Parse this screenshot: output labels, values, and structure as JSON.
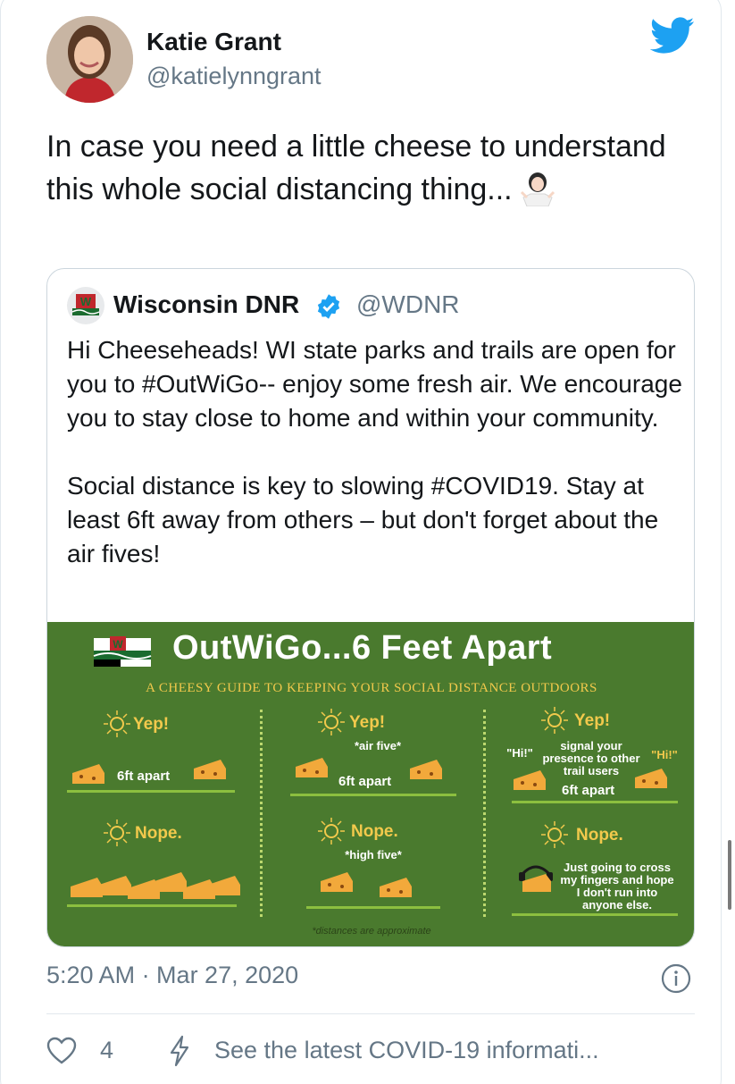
{
  "tweet": {
    "author_name": "Katie Grant",
    "author_handle": "@katielynngrant",
    "text": "In case you need a little cheese to understand this whole social distancing thing...",
    "emoji": "woman-shrugging",
    "timestamp": "5:20 AM · Mar 27, 2020",
    "like_count": "4",
    "covid_link": "See the latest COVID-19 informati..."
  },
  "quoted_tweet": {
    "author_name": "Wisconsin DNR",
    "author_handle": "@WDNR",
    "verified": true,
    "text": "Hi Cheeseheads! WI state parks and trails are open for you to #OutWiGo-- enjoy some fresh air. We encourage you to stay close to home and within your community.\n\nSocial distance is key to slowing #COVID19. Stay at least 6ft away from others – but don't forget about the air fives!"
  },
  "infographic": {
    "title": "OutWiGo...6 Feet Apart",
    "subtitle": "A CHEESY GUIDE TO KEEPING YOUR SOCIAL DISTANCE OUTDOORS",
    "yep": "Yep!",
    "nope": "Nope.",
    "col1": {
      "yep_distance": "6ft apart"
    },
    "col2": {
      "yep_caption": "*air five*",
      "yep_distance": "6ft apart",
      "nope_caption": "*high five*"
    },
    "col3": {
      "hi_left": "\"Hi!\"",
      "hi_right": "\"Hi!\"",
      "signal": "signal your presence to other trail users",
      "yep_distance": "6ft apart",
      "nope_caption": "Just going to cross my fingers and hope I don't run into anyone else."
    },
    "footnote": "*distances are approximate"
  },
  "colors": {
    "twitter_blue": "#1da1f2",
    "verified_blue": "#1da1f2",
    "infographic_green": "#4a7a2e",
    "cheese_yellow": "#f2c94c",
    "secondary_text": "#657786"
  }
}
